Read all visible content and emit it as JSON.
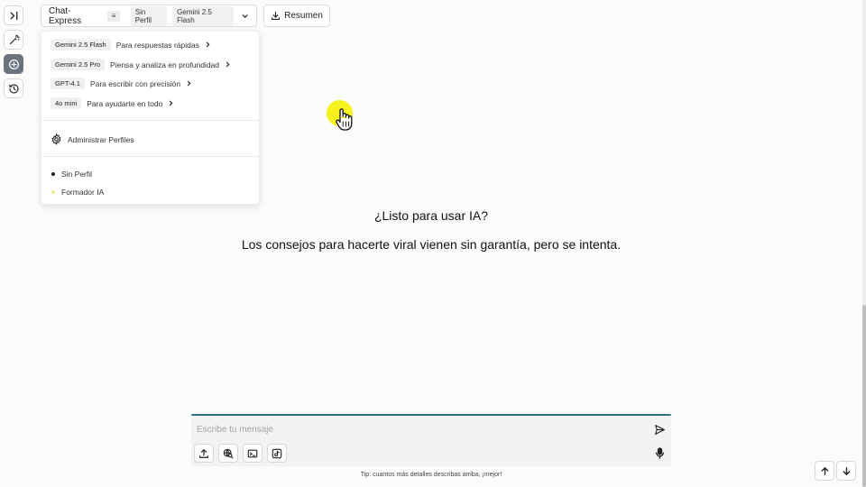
{
  "header": {
    "app_name": "Chat-Express",
    "menu_badge": "≡",
    "profile_chip": "Sin Perfil",
    "model_chip": "Gemini 2.5 Flash",
    "summary_label": "Resumen"
  },
  "dropdown": {
    "models": [
      {
        "tag": "Gemini 2.5 Flash",
        "desc": "Para respuestas rápidas"
      },
      {
        "tag": "Gemini 2.5 Pro",
        "desc": "Piensa y analiza en profundidad"
      },
      {
        "tag": "GPT-4.1",
        "desc": "Para escribir con precisión"
      },
      {
        "tag": "4o mini",
        "desc": "Para ayudarte en todo"
      }
    ],
    "manage_label": "Administrar Perfiles",
    "profiles": [
      {
        "label": "Sin Perfil",
        "dot_color": "#222222"
      },
      {
        "label": "Formador IA",
        "dot_color": "#f3e89a"
      }
    ]
  },
  "main": {
    "headline": "¿Listo para usar IA?",
    "subline": "Los consejos para hacerte viral vienen sin garantía, pero se intenta."
  },
  "composer": {
    "placeholder": "Escribe tu mensaje",
    "value": ""
  },
  "footer": {
    "tip": "Tip: cuantos más detalles describas arriba, ¡mejor!"
  },
  "colors": {
    "accent_border": "#2b6e86",
    "cursor_highlight": "#f7f11c",
    "active_rail": "#6b7280"
  },
  "icons": {
    "rail": [
      "expand-sidebar-icon",
      "magic-wand-icon",
      "new-chat-icon",
      "history-icon"
    ],
    "composer_tools": [
      "upload-icon",
      "web-search-icon",
      "terminal-icon",
      "tiktok-icon"
    ]
  }
}
